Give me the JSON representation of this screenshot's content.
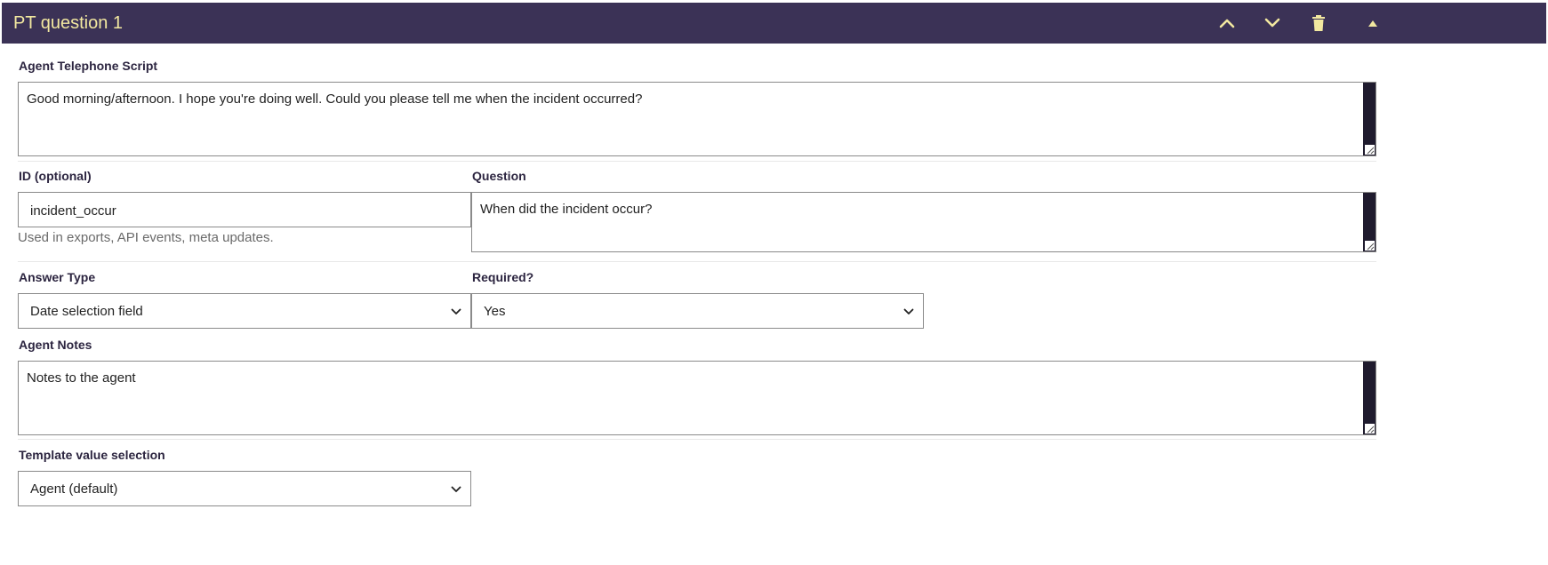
{
  "header": {
    "title": "PT question 1",
    "icons": [
      "chevron-up-icon",
      "chevron-down-icon",
      "trash-icon",
      "collapse-triangle-icon"
    ],
    "background_color": "#3b3256",
    "title_color": "#f2e8a0"
  },
  "agent_script": {
    "label": "Agent Telephone Script",
    "value": "Good morning/afternoon. I hope you're doing well. Could you please tell me when the incident occurred?"
  },
  "id_field": {
    "label": "ID (optional)",
    "value": "incident_occur",
    "help": "Used in exports, API events, meta updates."
  },
  "question": {
    "label": "Question",
    "value": "When did the incident occur?"
  },
  "answer_type": {
    "label": "Answer Type",
    "selected": "Date selection field"
  },
  "required": {
    "label": "Required?",
    "selected": "Yes"
  },
  "agent_notes": {
    "label": "Agent Notes",
    "value": "Notes to the agent"
  },
  "template_value": {
    "label": "Template value selection",
    "selected": "Agent (default)"
  }
}
